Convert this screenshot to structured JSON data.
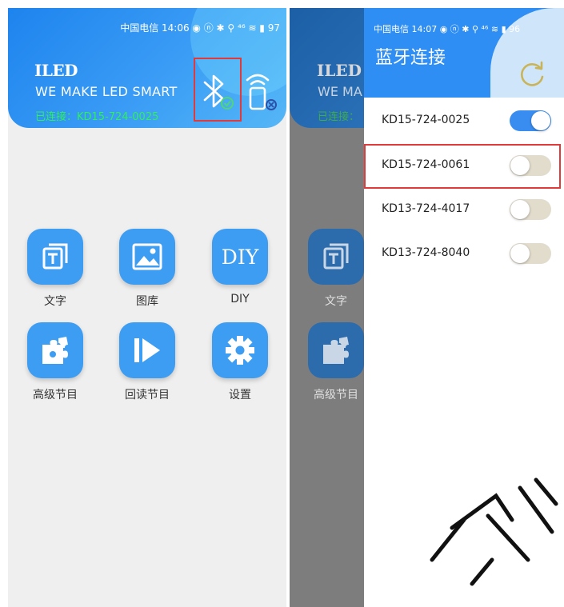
{
  "left_screen": {
    "status_bar": "中国电信 14:06  ◉ ⓝ ✱ ⚲ ⁴⁶ ≋ ▮ 97",
    "brand": "ILED",
    "slogan": "WE MAKE LED SMART",
    "connection_status": "已连接：KD15-724-0025",
    "tiles": [
      {
        "label": "文字",
        "icon": "text-icon"
      },
      {
        "label": "图库",
        "icon": "gallery-icon"
      },
      {
        "label": "DIY",
        "icon": "diy-icon",
        "icon_text": "DIY"
      },
      {
        "label": "高级节目",
        "icon": "puzzle-icon"
      },
      {
        "label": "回读节目",
        "icon": "play-icon"
      },
      {
        "label": "设置",
        "icon": "gear-icon"
      }
    ]
  },
  "right_screen": {
    "background_partial": {
      "brand": "ILED",
      "slogan": "WE MA",
      "connection_status": "已连接：",
      "tiles": [
        {
          "label": "文字"
        },
        {
          "label": "高级节目"
        }
      ]
    },
    "drawer": {
      "status_bar": "中国电信 14:07  ◉ ⓝ ✱ ⚲ ⁴⁶ ≋ ▮ 96",
      "title": "蓝牙连接",
      "devices": [
        {
          "name": "KD15-724-0025",
          "connected": true
        },
        {
          "name": "KD15-724-0061",
          "connected": false
        },
        {
          "name": "KD13-724-4017",
          "connected": false
        },
        {
          "name": "KD13-724-8040",
          "connected": false
        }
      ]
    }
  },
  "colors": {
    "accent_blue": "#3d9df3",
    "connected_green": "#2ff05a",
    "highlight_red": "#e03a3a",
    "refresh_gold": "#c9b45a"
  }
}
